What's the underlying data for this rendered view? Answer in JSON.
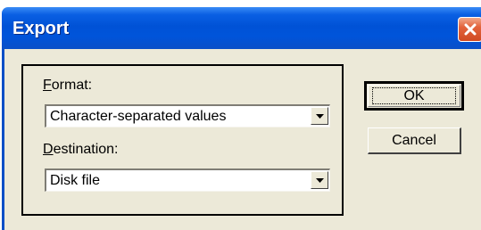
{
  "dialog": {
    "title": "Export",
    "close_icon": "close-icon"
  },
  "format": {
    "label_mnemonic": "F",
    "label_rest": "ormat:",
    "selected": "Character-separated values"
  },
  "destination": {
    "label_mnemonic": "D",
    "label_rest": "estination:",
    "selected": "Disk file"
  },
  "buttons": {
    "ok": "OK",
    "cancel": "Cancel"
  }
}
